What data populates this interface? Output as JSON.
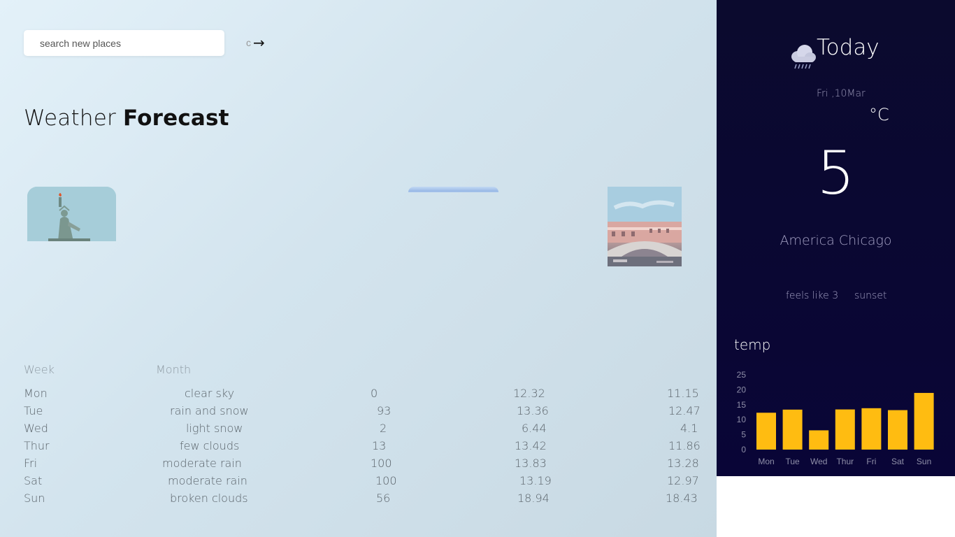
{
  "search": {
    "placeholder": "search new places",
    "peek_text": "c",
    "arrow": "→"
  },
  "title": {
    "light": "Weather ",
    "bold": "Forecast"
  },
  "cards": [
    {
      "name": "statue-of-liberty"
    },
    {
      "name": "sky"
    },
    {
      "name": "venice-rialto-bridge"
    }
  ],
  "tabs": {
    "week": "Week",
    "month": "Month"
  },
  "forecast": [
    {
      "day": "Mon",
      "desc": "clear sky",
      "humidity": "0",
      "max": "12.32",
      "min": "11.15"
    },
    {
      "day": "Tue",
      "desc": "rain and snow",
      "humidity": "93",
      "max": "13.36",
      "min": "12.47"
    },
    {
      "day": "Wed",
      "desc": "light snow",
      "humidity": "2",
      "max": "6.44",
      "min": "4.1"
    },
    {
      "day": "Thur",
      "desc": "few clouds",
      "humidity": "13",
      "max": "13.42",
      "min": "11.86"
    },
    {
      "day": "Fri",
      "desc": "moderate rain",
      "humidity": "100",
      "max": "13.83",
      "min": "13.28"
    },
    {
      "day": "Sat",
      "desc": "moderate rain",
      "humidity": "100",
      "max": "13.19",
      "min": "12.97"
    },
    {
      "day": "Sun",
      "desc": "broken clouds",
      "humidity": "56",
      "max": "18.94",
      "min": "18.43"
    }
  ],
  "today": {
    "label": "Today",
    "date": "Fri ,10Mar",
    "unit": "°C",
    "temperature": "5",
    "location": "America Chicago",
    "feels_like": "feels like 3",
    "sunset": "sunset",
    "icon": "rain-cloud-icon"
  },
  "chart_data": {
    "type": "bar",
    "title": "temp",
    "categories": [
      "Mon",
      "Tue",
      "Wed",
      "Thur",
      "Fri",
      "Sat",
      "Sun"
    ],
    "values": [
      12.32,
      13.36,
      6.44,
      13.42,
      13.83,
      13.19,
      18.94
    ],
    "yticks": [
      0,
      5,
      10,
      15,
      20,
      25
    ],
    "ylim": [
      0,
      25
    ],
    "color": "#ffbc11",
    "grid": false
  },
  "colors": {
    "sidebar_bg": "#0a0733",
    "bar": "#ffbc11",
    "accent_text": "#a4a2c4"
  }
}
